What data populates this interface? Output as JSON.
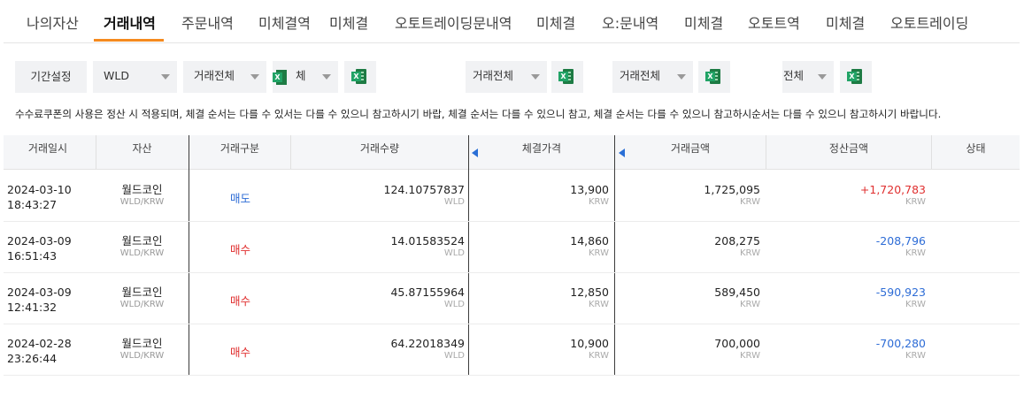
{
  "tabs": [
    {
      "label": "나의자산"
    },
    {
      "label": "거래내역",
      "active": true
    },
    {
      "label": "주문내역"
    },
    {
      "label": "미체결역"
    },
    {
      "label": "미체결"
    },
    {
      "label": "오토트레이딩문내역"
    },
    {
      "label": "미체결"
    },
    {
      "label": "오:문내역"
    },
    {
      "label": "미체결"
    },
    {
      "label": "오토트역"
    },
    {
      "label": "미체결"
    },
    {
      "label": "오토트레이딩"
    }
  ],
  "filters": {
    "period_label": "기간설정",
    "selects": [
      "WLD",
      "거래전체",
      "체",
      "거래전체",
      "거래전체",
      "전체"
    ]
  },
  "notice": "수수료쿠폰의 사용은 정산 시 적용되며, 체결 순서는 다를 수 있으니 참고하시기 바랍니다.",
  "notice_display": "수수료쿠폰의 사용은 정산 시 적용되며, 체결 순서는 다를 수 있서는 다를 수 있으니 참고하시기 바랍, 체결 순서는 다를 수 있으니 참고, 체결 순서는 다를 수 있으니 참고하시순서는 다를 수 있으니 참고하시기 바랍니다.",
  "table": {
    "headers": [
      "거래일시",
      "자산",
      "거래구분",
      "거래수량",
      "체결가격",
      "거래금액",
      "정산금액",
      "상태"
    ],
    "rows": [
      {
        "date": "2024-03-10",
        "time": "18:43:27",
        "asset": "월드코인",
        "pair": "WLD/KRW",
        "side": "매도",
        "side_type": "sell",
        "qty": "124.10757837",
        "qty_unit": "WLD",
        "price": "13,900",
        "price_unit": "KRW",
        "amount": "1,725,095",
        "amount_unit": "KRW",
        "settle": "+1,720,783",
        "settle_unit": "KRW",
        "settle_sign": "pos"
      },
      {
        "date": "2024-03-09",
        "time": "16:51:43",
        "asset": "월드코인",
        "pair": "WLD/KRW",
        "side": "매수",
        "side_type": "buy",
        "qty": "14.01583524",
        "qty_unit": "WLD",
        "price": "14,860",
        "price_unit": "KRW",
        "amount": "208,275",
        "amount_unit": "KRW",
        "settle": "-208,796",
        "settle_unit": "KRW",
        "settle_sign": "neg"
      },
      {
        "date": "2024-03-09",
        "time": "12:41:32",
        "asset": "월드코인",
        "pair": "WLD/KRW",
        "side": "매수",
        "side_type": "buy",
        "qty": "45.87155964",
        "qty_unit": "WLD",
        "price": "12,850",
        "price_unit": "KRW",
        "amount": "589,450",
        "amount_unit": "KRW",
        "settle": "-590,923",
        "settle_unit": "KRW",
        "settle_sign": "neg"
      },
      {
        "date": "2024-02-28",
        "time": "23:26:44",
        "asset": "월드코인",
        "pair": "WLD/KRW",
        "side": "매수",
        "side_type": "buy",
        "qty": "64.22018349",
        "qty_unit": "WLD",
        "price": "10,900",
        "price_unit": "KRW",
        "amount": "700,000",
        "amount_unit": "KRW",
        "settle": "-700,280",
        "settle_unit": "KRW",
        "settle_sign": "neg"
      }
    ]
  },
  "colors": {
    "accent": "#f58a1f",
    "sell": "#2d6cd6",
    "buy": "#e03030",
    "excel": "#1e7b44"
  }
}
